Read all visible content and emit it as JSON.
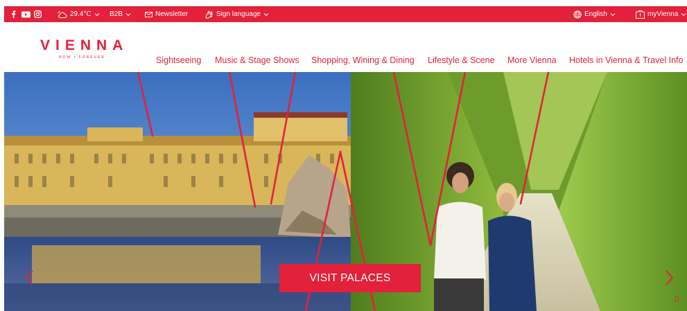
{
  "topbar": {
    "weather": "29.4°C",
    "b2b": "B2B",
    "newsletter": "Newsletter",
    "sign_language": "Sign language",
    "language": "English",
    "my_vienna": "myVienna"
  },
  "logo": {
    "word": "VIENNA",
    "tagline": "NOW • FOREVER"
  },
  "nav": {
    "items": [
      {
        "label": "Sightseeing"
      },
      {
        "label": "Music & Stage Shows"
      },
      {
        "label": "Shopping, Wining & Dining"
      },
      {
        "label": "Lifestyle & Scene"
      },
      {
        "label": "More Vienna"
      },
      {
        "label": "Hotels in Vienna & Travel Info"
      }
    ]
  },
  "hero": {
    "cta_label": "VISIT PALACES"
  },
  "colors": {
    "brand_red": "#e3213a",
    "white": "#ffffff"
  },
  "icons": [
    "facebook-icon",
    "youtube-icon",
    "instagram-icon",
    "weather-icon",
    "mail-icon",
    "sign-language-icon",
    "globe-icon",
    "bookmark-icon",
    "chevron-down-icon",
    "chevron-left-icon",
    "chevron-right-icon"
  ]
}
